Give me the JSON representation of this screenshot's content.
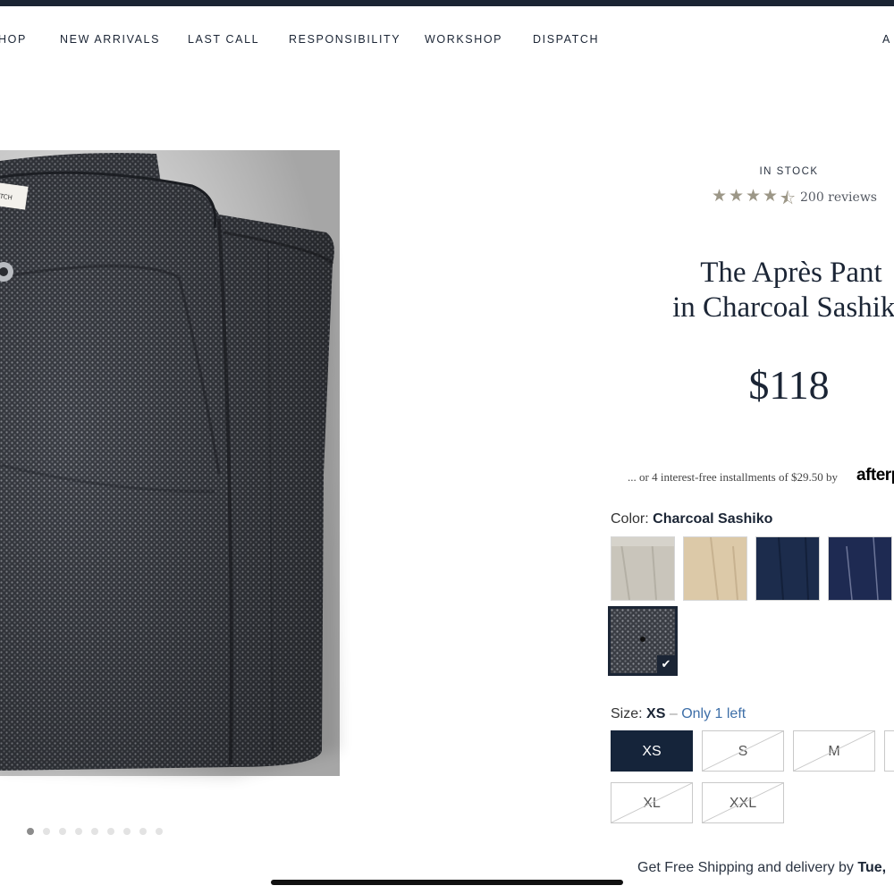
{
  "nav": {
    "items": [
      "HOP",
      "NEW ARRIVALS",
      "LAST CALL",
      "RESPONSIBILITY",
      "WORKSHOP",
      "DISPATCH",
      "A"
    ]
  },
  "gallery": {
    "image_icon": "folded-pants-photo",
    "label_text": "TCH",
    "current_index": 1,
    "total_images": 9
  },
  "product": {
    "stock_status": "IN STOCK",
    "rating": 4.5,
    "rating_max": 5,
    "star_icons": [
      "star-icon",
      "star-icon",
      "star-icon",
      "star-icon",
      "half-star-icon"
    ],
    "reviews": "200 reviews",
    "title_line1": "The Après Pant",
    "title_line2": "in Charcoal Sashiko",
    "price": "$118",
    "installments": "... or 4 interest-free installments of $29.50 by",
    "afterpay_logo": "afterpay",
    "color_label": "Color:",
    "color_value": "Charcoal Sashiko",
    "swatch_colors": [
      "#c9c5bb",
      "#dcc9a8",
      "#1c2c4c",
      "#1e2a52",
      "#2c2e32"
    ],
    "selected_swatch_index": 4,
    "size_label": "Size:",
    "size_value": "XS",
    "size_separator": "–",
    "size_stock_note": "Only 1 left",
    "sizes": [
      "XS",
      "S",
      "M",
      "",
      "XL",
      "XXL"
    ],
    "selected_size": "XS",
    "shipping_text": "Get Free Shipping and delivery by",
    "shipping_date": "Tue,"
  },
  "colors": {
    "navy": "#1b2535",
    "accent_link": "#3e6fa8",
    "star": "#9c9787"
  }
}
